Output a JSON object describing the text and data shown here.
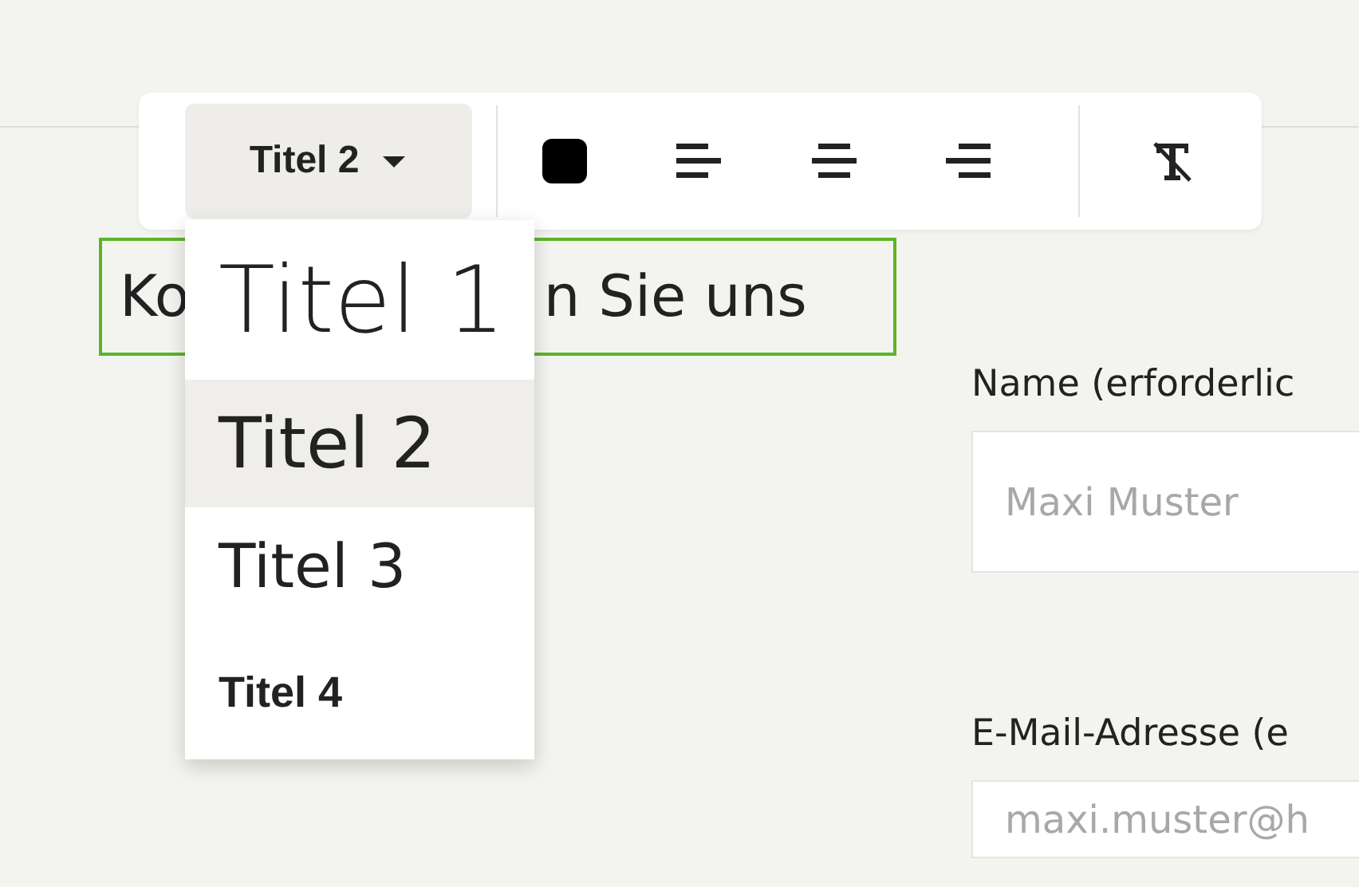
{
  "toolbar": {
    "style_select": {
      "label": "Titel 2",
      "expanded": true
    },
    "text_color": {
      "color": "#000000"
    },
    "tools": [
      {
        "kind": "align-left"
      },
      {
        "kind": "align-center"
      },
      {
        "kind": "align-right"
      },
      {
        "kind": "clear-format"
      }
    ]
  },
  "style_menu": [
    {
      "label": "Titel 1",
      "kind": "h1",
      "selected": false
    },
    {
      "label": "Titel 2",
      "kind": "h2",
      "selected": true
    },
    {
      "label": "Titel 3",
      "kind": "h3",
      "selected": false
    },
    {
      "label": "Titel 4",
      "kind": "h4",
      "selected": false
    }
  ],
  "heading": {
    "parts": [
      "Ko",
      "n Sie uns"
    ]
  },
  "form": {
    "fields": [
      {
        "label": "Name (erforderlic",
        "placeholder": "Maxi Muster"
      },
      {
        "label": "E-Mail-Adresse (e",
        "placeholder": "maxi.muster@h"
      }
    ]
  }
}
